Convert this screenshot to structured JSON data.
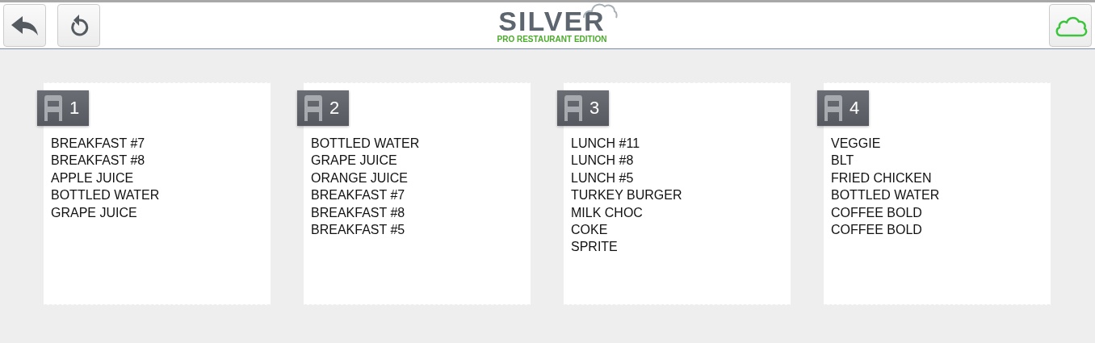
{
  "header": {
    "logo_title": "SILVER",
    "logo_subtitle": "PRO RESTAURANT EDITION"
  },
  "seats": [
    {
      "number": "1",
      "items": [
        "BREAKFAST #7",
        "BREAKFAST #8",
        "APPLE JUICE",
        "BOTTLED WATER",
        "GRAPE JUICE"
      ]
    },
    {
      "number": "2",
      "items": [
        "BOTTLED WATER",
        "GRAPE JUICE",
        "ORANGE JUICE",
        "BREAKFAST #7",
        "BREAKFAST #8",
        "BREAKFAST #5"
      ]
    },
    {
      "number": "3",
      "items": [
        "LUNCH #11",
        "LUNCH #8",
        "LUNCH #5",
        "TURKEY BURGER",
        "MILK CHOC",
        "COKE",
        "SPRITE"
      ]
    },
    {
      "number": "4",
      "items": [
        "VEGGIE",
        "BLT",
        "FRIED CHICKEN",
        "BOTTLED WATER",
        "COFFEE BOLD",
        "COFFEE BOLD"
      ]
    }
  ]
}
